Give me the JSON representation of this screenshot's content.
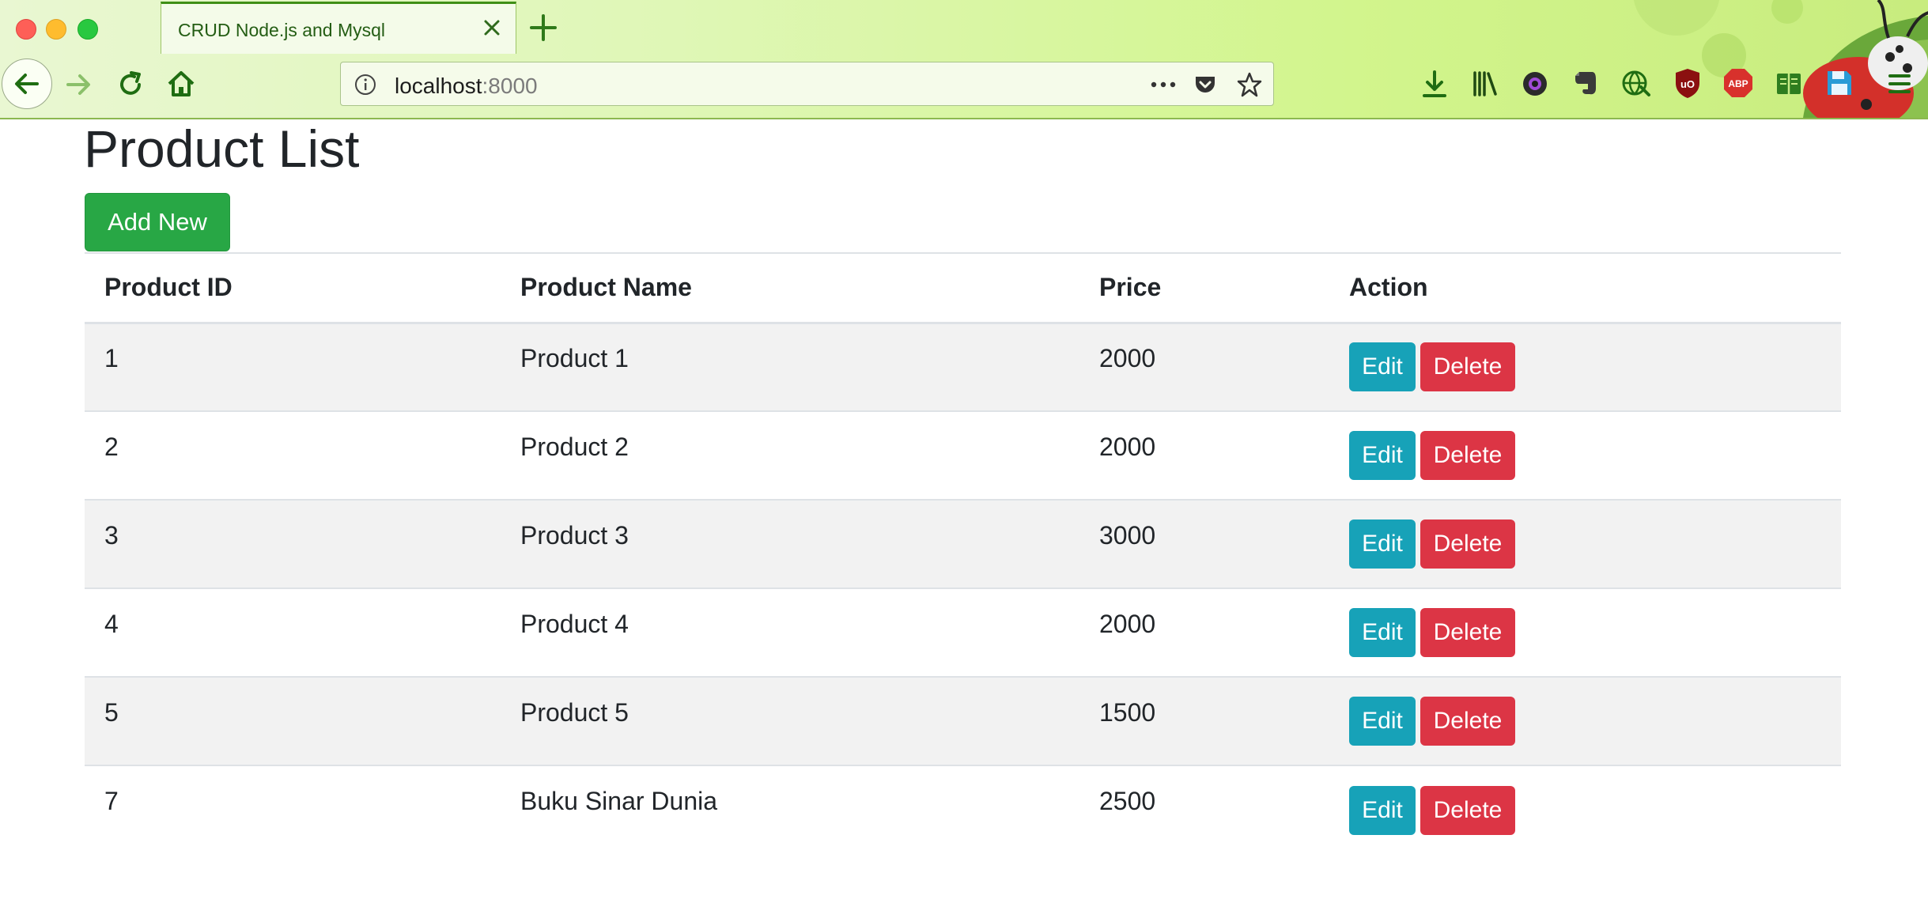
{
  "browser": {
    "tab_title": "CRUD Node.js and Mysql",
    "url_host": "localhost",
    "url_port": ":8000",
    "toolbar_icons": [
      "download-icon",
      "library-icon",
      "extension-camera-icon",
      "evernote-icon",
      "translate-icon",
      "ublock-icon",
      "adblock-plus-icon",
      "reader-icon",
      "save-icon",
      "menu-icon"
    ],
    "extension_badges": {
      "ublock": "uO",
      "adblock": "ABP"
    },
    "theme_colors": {
      "accent": "#3f8f16",
      "chrome_bg": "#d2f58d"
    }
  },
  "page": {
    "title": "Product List",
    "add_button": "Add New"
  },
  "table": {
    "headers": [
      "Product ID",
      "Product Name",
      "Price",
      "Action"
    ],
    "rows": [
      {
        "id": "1",
        "name": "Product 1",
        "price": "2000"
      },
      {
        "id": "2",
        "name": "Product 2",
        "price": "2000"
      },
      {
        "id": "3",
        "name": "Product 3",
        "price": "3000"
      },
      {
        "id": "4",
        "name": "Product 4",
        "price": "2000"
      },
      {
        "id": "5",
        "name": "Product 5",
        "price": "1500"
      },
      {
        "id": "7",
        "name": "Buku Sinar Dunia",
        "price": "2500"
      }
    ],
    "edit_label": "Edit",
    "delete_label": "Delete"
  },
  "colors": {
    "success": "#28a745",
    "info": "#17a2b8",
    "danger": "#dc3545",
    "stripe": "#f2f2f2"
  }
}
